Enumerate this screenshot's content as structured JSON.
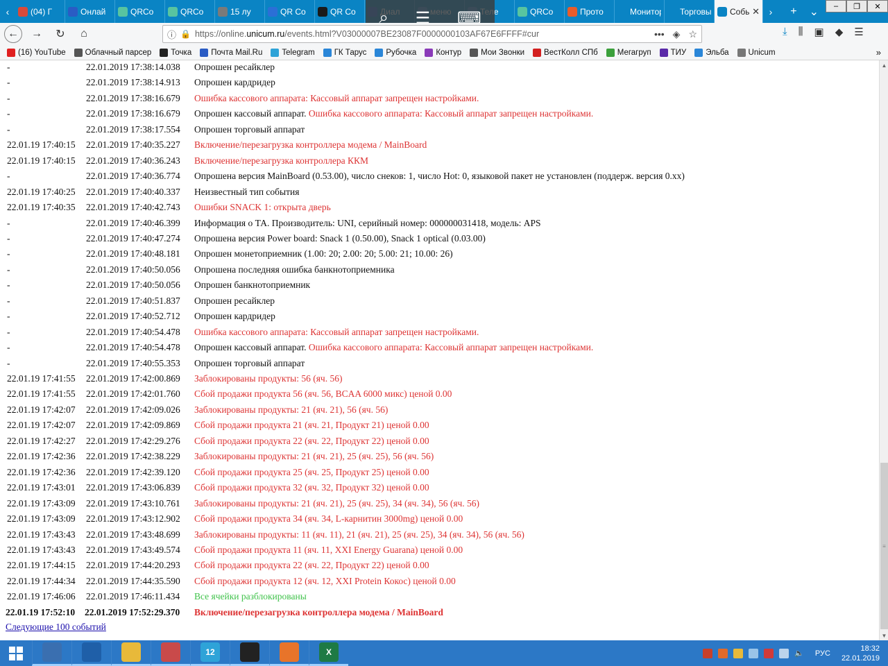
{
  "tabs": [
    {
      "label": "(04) Г",
      "icon_color": "#d84a3a"
    },
    {
      "label": "Онлай",
      "icon_color": "#2a5cc4"
    },
    {
      "label": "QRCo",
      "icon_color": "#58c4a0"
    },
    {
      "label": "QRCo",
      "icon_color": "#58c4a0"
    },
    {
      "label": "15 лу",
      "icon_color": "#7a7a7a"
    },
    {
      "label": "QR Co",
      "icon_color": "#2b6fd6"
    },
    {
      "label": "QR Co",
      "icon_color": "#1a1a1a"
    },
    {
      "label": "Диал",
      "icon_color": "#2b6fd6"
    },
    {
      "label": "меню",
      "icon_color": "#3a8fd8"
    },
    {
      "label": "Теле",
      "icon_color": "#3a8fd8"
    },
    {
      "label": "QRCo",
      "icon_color": "#58c4a0"
    },
    {
      "label": "Прото",
      "icon_color": "#e85c2a"
    },
    {
      "label": "Монитор",
      "icon_color": "#0a84c4"
    },
    {
      "label": "Торговый",
      "icon_color": "#0a84c4"
    },
    {
      "label": "Событ",
      "icon_color": "#0a84c4",
      "active": true
    }
  ],
  "address": {
    "url_prefix": "https://online.",
    "url_host": "unicum.ru",
    "url_rest": "/events.html?V03000007BE23087F0000000103AF67E6FFFF#cur"
  },
  "bookmarks": [
    {
      "label": "(16) YouTube",
      "color": "#e02020"
    },
    {
      "label": "Облачный парсер",
      "color": "#555555"
    },
    {
      "label": "Точка",
      "color": "#222222"
    },
    {
      "label": "Почта Mail.Ru",
      "color": "#2a5cc4"
    },
    {
      "label": "Telegram",
      "color": "#2ea3d8"
    },
    {
      "label": "ГК Тарус",
      "color": "#2a86d8"
    },
    {
      "label": "Рубочка",
      "color": "#2a86d8"
    },
    {
      "label": "Контур",
      "color": "#8a3ab8"
    },
    {
      "label": "Мои Звонки",
      "color": "#555555"
    },
    {
      "label": "ВестКолл СПб",
      "color": "#d32020"
    },
    {
      "label": "Мегагруп",
      "color": "#3ba03b"
    },
    {
      "label": "ТИУ",
      "color": "#5a2aa8"
    },
    {
      "label": "Эльба",
      "color": "#2a86d8"
    },
    {
      "label": "Unicum",
      "color": "#777777"
    }
  ],
  "events": [
    {
      "c1": "-",
      "c2": "22.01.2019 17:38:14.038",
      "parts": [
        {
          "t": "Опрошен ресайклер",
          "s": "black"
        }
      ]
    },
    {
      "c1": "-",
      "c2": "22.01.2019 17:38:14.913",
      "parts": [
        {
          "t": "Опрошен кардридер",
          "s": "black"
        }
      ]
    },
    {
      "c1": "-",
      "c2": "22.01.2019 17:38:16.679",
      "parts": [
        {
          "t": "Ошибка кассового аппарата: Кассовый аппарат запрещен настройками.",
          "s": "red"
        }
      ]
    },
    {
      "c1": "-",
      "c2": "22.01.2019 17:38:16.679",
      "parts": [
        {
          "t": "Опрошен кассовый аппарат. ",
          "s": "black"
        },
        {
          "t": "Ошибка кассового аппарата: Кассовый аппарат запрещен настройками.",
          "s": "red"
        }
      ]
    },
    {
      "c1": "-",
      "c2": "22.01.2019 17:38:17.554",
      "parts": [
        {
          "t": "Опрошен торговый аппарат",
          "s": "black"
        }
      ]
    },
    {
      "c1": "22.01.19 17:40:15",
      "c2": "22.01.2019 17:40:35.227",
      "parts": [
        {
          "t": "Включение/перезагрузка контроллера модема / MainBoard",
          "s": "red"
        }
      ]
    },
    {
      "c1": "22.01.19 17:40:15",
      "c2": "22.01.2019 17:40:36.243",
      "parts": [
        {
          "t": "Включение/перезагрузка контроллера ККМ",
          "s": "red"
        }
      ]
    },
    {
      "c1": "-",
      "c2": "22.01.2019 17:40:36.774",
      "parts": [
        {
          "t": "Опрошена версия MainBoard (0.53.00), число снеков: 1, число Hot: 0, языковой пакет не установлен (поддерж. версия 0.xx)",
          "s": "black"
        }
      ]
    },
    {
      "c1": "22.01.19 17:40:25",
      "c2": "22.01.2019 17:40:40.337",
      "parts": [
        {
          "t": "Неизвестный тип события",
          "s": "black"
        }
      ]
    },
    {
      "c1": "22.01.19 17:40:35",
      "c2": "22.01.2019 17:40:42.743",
      "parts": [
        {
          "t": "Ошибки SNACK 1: открыта дверь",
          "s": "red"
        }
      ]
    },
    {
      "c1": "-",
      "c2": "22.01.2019 17:40:46.399",
      "parts": [
        {
          "t": "Информация о ТА. Производитель: UNI, серийный номер: 000000031418, модель: APS",
          "s": "black"
        }
      ]
    },
    {
      "c1": "-",
      "c2": "22.01.2019 17:40:47.274",
      "parts": [
        {
          "t": "Опрошена версия Power board: Snack 1 (0.50.00), Snack 1 optical (0.03.00)",
          "s": "black"
        }
      ]
    },
    {
      "c1": "-",
      "c2": "22.01.2019 17:40:48.181",
      "parts": [
        {
          "t": "Опрошен монетоприемник (1.00: 20; 2.00: 20; 5.00: 21; 10.00: 26)",
          "s": "black"
        }
      ]
    },
    {
      "c1": "-",
      "c2": "22.01.2019 17:40:50.056",
      "parts": [
        {
          "t": "Опрошена последняя ошибка банкнотоприемника",
          "s": "black"
        }
      ]
    },
    {
      "c1": "-",
      "c2": "22.01.2019 17:40:50.056",
      "parts": [
        {
          "t": "Опрошен банкнотоприемник",
          "s": "black"
        }
      ]
    },
    {
      "c1": "-",
      "c2": "22.01.2019 17:40:51.837",
      "parts": [
        {
          "t": "Опрошен ресайклер",
          "s": "black"
        }
      ]
    },
    {
      "c1": "-",
      "c2": "22.01.2019 17:40:52.712",
      "parts": [
        {
          "t": "Опрошен кардридер",
          "s": "black"
        }
      ]
    },
    {
      "c1": "-",
      "c2": "22.01.2019 17:40:54.478",
      "parts": [
        {
          "t": "Ошибка кассового аппарата: Кассовый аппарат запрещен настройками.",
          "s": "red"
        }
      ]
    },
    {
      "c1": "-",
      "c2": "22.01.2019 17:40:54.478",
      "parts": [
        {
          "t": "Опрошен кассовый аппарат. ",
          "s": "black"
        },
        {
          "t": "Ошибка кассового аппарата: Кассовый аппарат запрещен настройками.",
          "s": "red"
        }
      ]
    },
    {
      "c1": "-",
      "c2": "22.01.2019 17:40:55.353",
      "parts": [
        {
          "t": "Опрошен торговый аппарат",
          "s": "black"
        }
      ]
    },
    {
      "c1": "22.01.19 17:41:55",
      "c2": "22.01.2019 17:42:00.869",
      "parts": [
        {
          "t": "Заблокированы продукты: 56 (яч. 56)",
          "s": "red"
        }
      ]
    },
    {
      "c1": "22.01.19 17:41:55",
      "c2": "22.01.2019 17:42:01.760",
      "parts": [
        {
          "t": "Сбой продажи продукта 56 (яч. 56, BCAA 6000 микс) ценой 0.00",
          "s": "red"
        }
      ]
    },
    {
      "c1": "22.01.19 17:42:07",
      "c2": "22.01.2019 17:42:09.026",
      "parts": [
        {
          "t": "Заблокированы продукты: 21 (яч. 21), 56 (яч. 56)",
          "s": "red"
        }
      ]
    },
    {
      "c1": "22.01.19 17:42:07",
      "c2": "22.01.2019 17:42:09.869",
      "parts": [
        {
          "t": "Сбой продажи продукта 21 (яч. 21, Продукт 21) ценой 0.00",
          "s": "red"
        }
      ]
    },
    {
      "c1": "22.01.19 17:42:27",
      "c2": "22.01.2019 17:42:29.276",
      "parts": [
        {
          "t": "Сбой продажи продукта 22 (яч. 22, Продукт 22) ценой 0.00",
          "s": "red"
        }
      ]
    },
    {
      "c1": "22.01.19 17:42:36",
      "c2": "22.01.2019 17:42:38.229",
      "parts": [
        {
          "t": "Заблокированы продукты: 21 (яч. 21), 25 (яч. 25), 56 (яч. 56)",
          "s": "red"
        }
      ]
    },
    {
      "c1": "22.01.19 17:42:36",
      "c2": "22.01.2019 17:42:39.120",
      "parts": [
        {
          "t": "Сбой продажи продукта 25 (яч. 25, Продукт 25) ценой 0.00",
          "s": "red"
        }
      ]
    },
    {
      "c1": "22.01.19 17:43:01",
      "c2": "22.01.2019 17:43:06.839",
      "parts": [
        {
          "t": "Сбой продажи продукта 32 (яч. 32, Продукт 32) ценой 0.00",
          "s": "red"
        }
      ]
    },
    {
      "c1": "22.01.19 17:43:09",
      "c2": "22.01.2019 17:43:10.761",
      "parts": [
        {
          "t": "Заблокированы продукты: 21 (яч. 21), 25 (яч. 25), 34 (яч. 34), 56 (яч. 56)",
          "s": "red"
        }
      ]
    },
    {
      "c1": "22.01.19 17:43:09",
      "c2": "22.01.2019 17:43:12.902",
      "parts": [
        {
          "t": "Сбой продажи продукта 34 (яч. 34, L-карнитин 3000mg) ценой 0.00",
          "s": "red"
        }
      ]
    },
    {
      "c1": "22.01.19 17:43:43",
      "c2": "22.01.2019 17:43:48.699",
      "parts": [
        {
          "t": "Заблокированы продукты: 11 (яч. 11), 21 (яч. 21), 25 (яч. 25), 34 (яч. 34), 56 (яч. 56)",
          "s": "red"
        }
      ]
    },
    {
      "c1": "22.01.19 17:43:43",
      "c2": "22.01.2019 17:43:49.574",
      "parts": [
        {
          "t": "Сбой продажи продукта 11 (яч. 11, XXI Energy Guarana) ценой 0.00",
          "s": "red"
        }
      ]
    },
    {
      "c1": "22.01.19 17:44:15",
      "c2": "22.01.2019 17:44:20.293",
      "parts": [
        {
          "t": "Сбой продажи продукта 22 (яч. 22, Продукт 22) ценой 0.00",
          "s": "red"
        }
      ]
    },
    {
      "c1": "22.01.19 17:44:34",
      "c2": "22.01.2019 17:44:35.590",
      "parts": [
        {
          "t": "Сбой продажи продукта 12 (яч. 12, XXI Protein Кокос) ценой 0.00",
          "s": "red"
        }
      ]
    },
    {
      "c1": "22.01.19 17:46:06",
      "c2": "22.01.2019 17:46:11.434",
      "parts": [
        {
          "t": "Все ячейки разблокированы",
          "s": "green"
        }
      ]
    },
    {
      "c1": "22.01.19 17:52:10",
      "c2": "22.01.2019 17:52:29.370",
      "bold": true,
      "parts": [
        {
          "t": "Включение/перезагрузка контроллера модема / MainBoard",
          "s": "red"
        }
      ]
    }
  ],
  "next_link": "Следующие 100 событий",
  "taskbar": {
    "apps": [
      {
        "name": "network-app",
        "color": "#3a6fb0",
        "label": ""
      },
      {
        "name": "powershell-app",
        "color": "#1f5fa8",
        "label": ""
      },
      {
        "name": "explorer-app",
        "color": "#e8b93a",
        "label": ""
      },
      {
        "name": "notes-app",
        "color": "#c94a4a",
        "label": ""
      },
      {
        "name": "telegram-app",
        "color": "#2ea3d8",
        "label": "12"
      },
      {
        "name": "security-app",
        "color": "#222222",
        "label": ""
      },
      {
        "name": "firefox-app",
        "color": "#e8742a",
        "label": ""
      },
      {
        "name": "excel-app",
        "color": "#1e7a44",
        "label": "X"
      }
    ],
    "lang": "РУС",
    "time": "18:32",
    "date": "22.01.2019"
  },
  "colors": {
    "tabstrip": "#0a84c4",
    "error_red": "#d33333",
    "ok_green": "#3fc24a",
    "taskbar": "#2c78c6"
  }
}
